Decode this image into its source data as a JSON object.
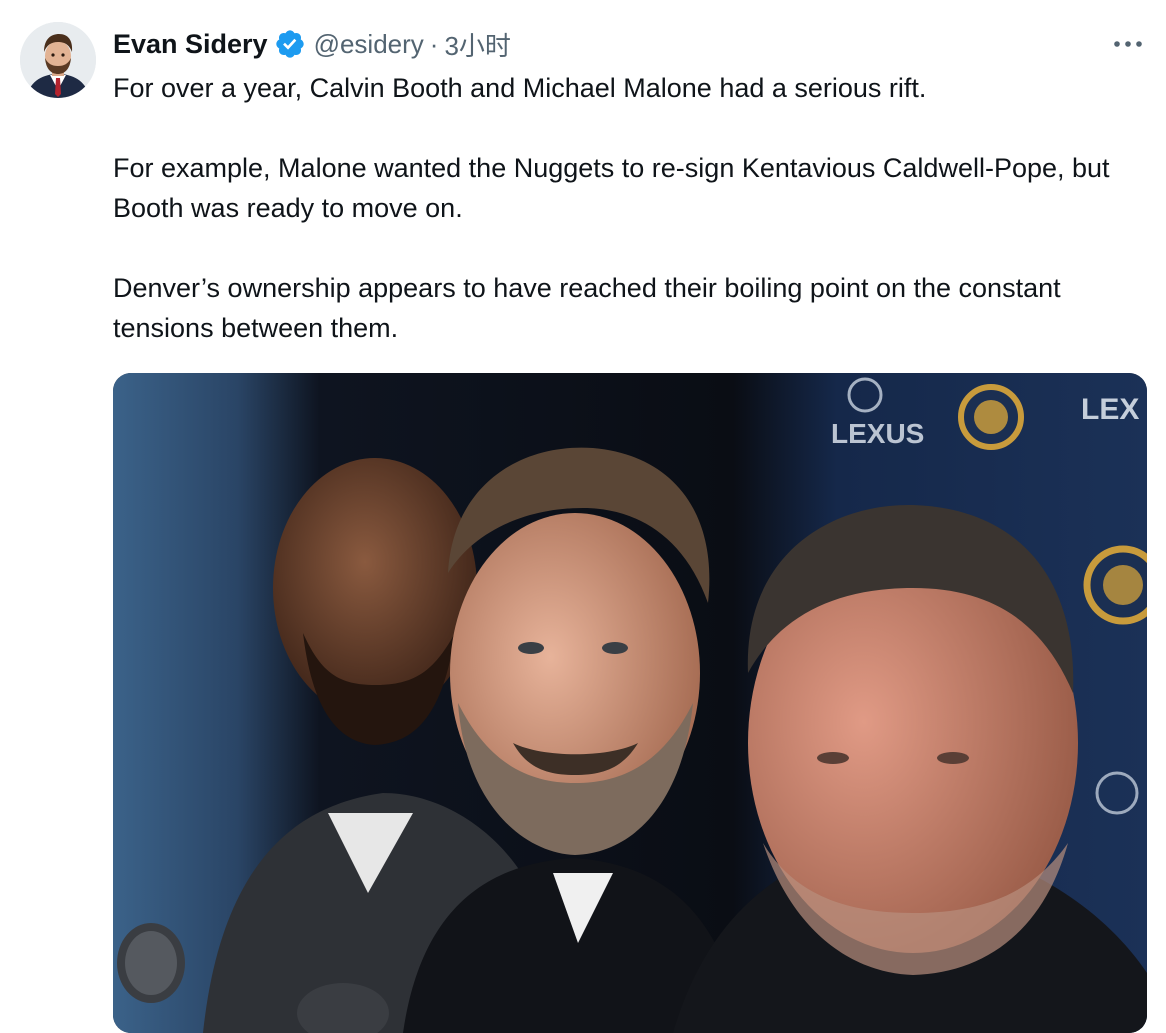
{
  "tweet": {
    "author": {
      "name": "Evan Sidery",
      "handle": "@esidery",
      "verified_icon": "verified-badge-icon"
    },
    "separator": "·",
    "time": "3小时",
    "more_icon": "more-horizontal-icon",
    "paragraphs": [
      "For over a year, Calvin Booth and Michael Malone had a serious rift.",
      "For example, Malone wanted the Nuggets to re-sign Kentavious Caldwell-Pope, but Booth was ready to move on.",
      "Denver’s ownership appears to have reached their boiling point on the constant tensions between them."
    ],
    "media": {
      "type": "photo",
      "backdrop_logos": [
        "LEXUS",
        "LEX"
      ]
    }
  },
  "colors": {
    "text_primary": "#0f1419",
    "text_secondary": "#536471",
    "verified_blue": "#1d9bf0",
    "backdrop_navy": "#15284a",
    "nuggets_gold": "#c89b3c"
  }
}
